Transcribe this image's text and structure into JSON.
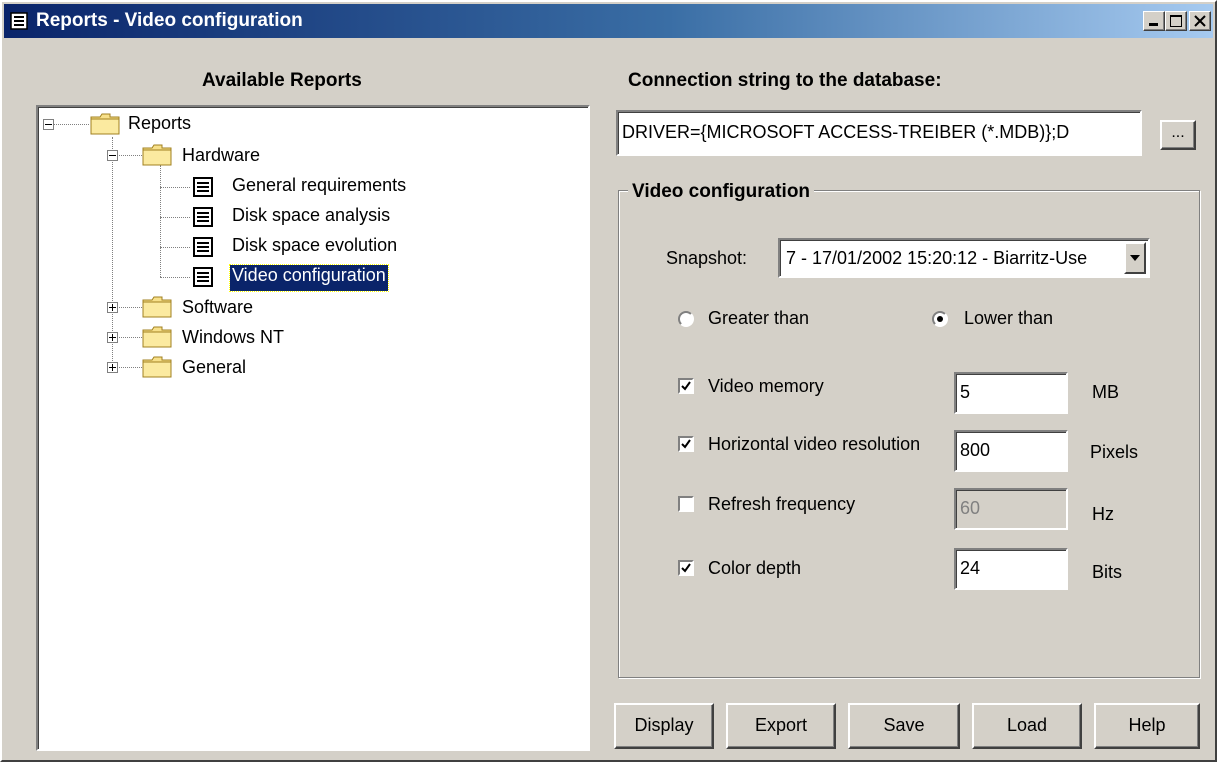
{
  "window": {
    "title": "Reports - Video configuration",
    "icons": {
      "title": "report-doc-icon",
      "minimize": "minimize-icon",
      "maximize": "maximize-icon",
      "close": "close-icon"
    }
  },
  "left_panel": {
    "heading": "Available Reports",
    "tree": [
      {
        "label": "Reports",
        "icon": "folder-icon",
        "expander": "minus"
      },
      {
        "label": "Hardware",
        "icon": "folder-icon",
        "expander": "minus"
      },
      {
        "label": "General requirements",
        "icon": "report-doc-icon"
      },
      {
        "label": "Disk space analysis",
        "icon": "report-doc-icon"
      },
      {
        "label": "Disk space evolution",
        "icon": "report-doc-icon"
      },
      {
        "label": "Video configuration",
        "icon": "report-doc-icon",
        "selected": true
      },
      {
        "label": "Software",
        "icon": "folder-icon",
        "expander": "plus"
      },
      {
        "label": "Windows NT",
        "icon": "folder-icon",
        "expander": "plus"
      },
      {
        "label": "General",
        "icon": "folder-icon",
        "expander": "plus"
      }
    ]
  },
  "right_panel": {
    "connection_heading": "Connection string to the database:",
    "connection_value": "DRIVER={MICROSOFT ACCESS-TREIBER (*.MDB)};D",
    "browse_label": "...",
    "group_title": "Video configuration",
    "snapshot_label": "Snapshot:",
    "snapshot_value": "7 - 17/01/2002 15:20:12 - Biarritz-Use",
    "radio_greater": "Greater than",
    "radio_lower": "Lower than",
    "radio_selected": "lower",
    "criteria": [
      {
        "label": "Video memory",
        "checked": true,
        "value": "5",
        "unit": "MB",
        "enabled": true
      },
      {
        "label": "Horizontal video resolution",
        "checked": true,
        "value": "800",
        "unit": "Pixels",
        "enabled": true
      },
      {
        "label": "Refresh frequency",
        "checked": false,
        "value": "60",
        "unit": "Hz",
        "enabled": false
      },
      {
        "label": "Color depth",
        "checked": true,
        "value": "24",
        "unit": "Bits",
        "enabled": true
      }
    ]
  },
  "buttons": {
    "display": "Display",
    "export": "Export",
    "save": "Save",
    "load": "Load",
    "help": "Help"
  },
  "colors": {
    "titlebar_start": "#0a246a",
    "titlebar_end": "#a6caf0",
    "face": "#d4d0c8",
    "selection": "#0a246a"
  }
}
